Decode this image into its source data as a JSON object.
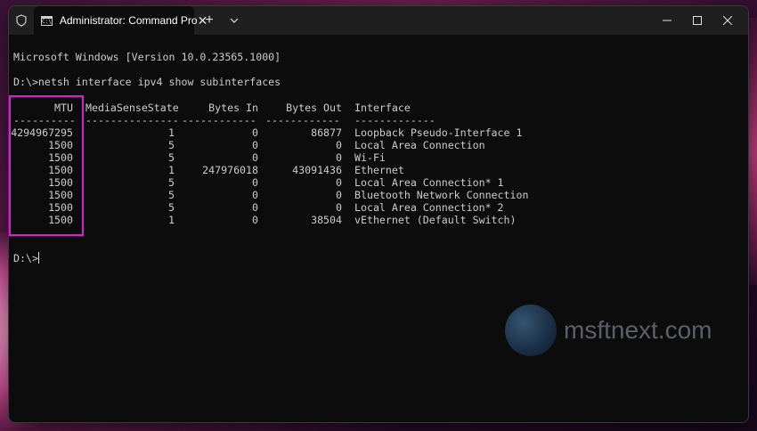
{
  "window": {
    "tab_title": "Administrator: Command Pro",
    "tab_icon_text": "C:\\",
    "new_tab": "+",
    "dropdown": "⌄",
    "close_tab": "✕",
    "minimize": "—",
    "maximize": "☐",
    "close": "✕"
  },
  "terminal": {
    "version_line": "Microsoft Windows [Version 10.0.23565.1000]",
    "command_line": "D:\\>netsh interface ipv4 show subinterfaces",
    "headers": [
      "MTU",
      "MediaSenseState",
      "Bytes In",
      "Bytes Out",
      "Interface"
    ],
    "separators": [
      "----------",
      "---------------",
      "------------",
      "------------",
      "-------------"
    ],
    "rows": [
      {
        "mtu": "4294967295",
        "state": "1",
        "bytes_in": "0",
        "bytes_out": "86877",
        "interface": "Loopback Pseudo-Interface 1"
      },
      {
        "mtu": "1500",
        "state": "5",
        "bytes_in": "0",
        "bytes_out": "0",
        "interface": "Local Area Connection"
      },
      {
        "mtu": "1500",
        "state": "5",
        "bytes_in": "0",
        "bytes_out": "0",
        "interface": "Wi-Fi"
      },
      {
        "mtu": "1500",
        "state": "1",
        "bytes_in": "247976018",
        "bytes_out": "43091436",
        "interface": "Ethernet"
      },
      {
        "mtu": "1500",
        "state": "5",
        "bytes_in": "0",
        "bytes_out": "0",
        "interface": "Local Area Connection* 1"
      },
      {
        "mtu": "1500",
        "state": "5",
        "bytes_in": "0",
        "bytes_out": "0",
        "interface": "Bluetooth Network Connection"
      },
      {
        "mtu": "1500",
        "state": "5",
        "bytes_in": "0",
        "bytes_out": "0",
        "interface": "Local Area Connection* 2"
      },
      {
        "mtu": "1500",
        "state": "1",
        "bytes_in": "0",
        "bytes_out": "38504",
        "interface": "vEthernet (Default Switch)"
      }
    ],
    "prompt": "D:\\>"
  },
  "watermark": {
    "text": "msftnext.com"
  },
  "colors": {
    "highlight": "#e01ad8",
    "terminal_bg": "#0c0c0c",
    "terminal_fg": "#cccccc"
  }
}
